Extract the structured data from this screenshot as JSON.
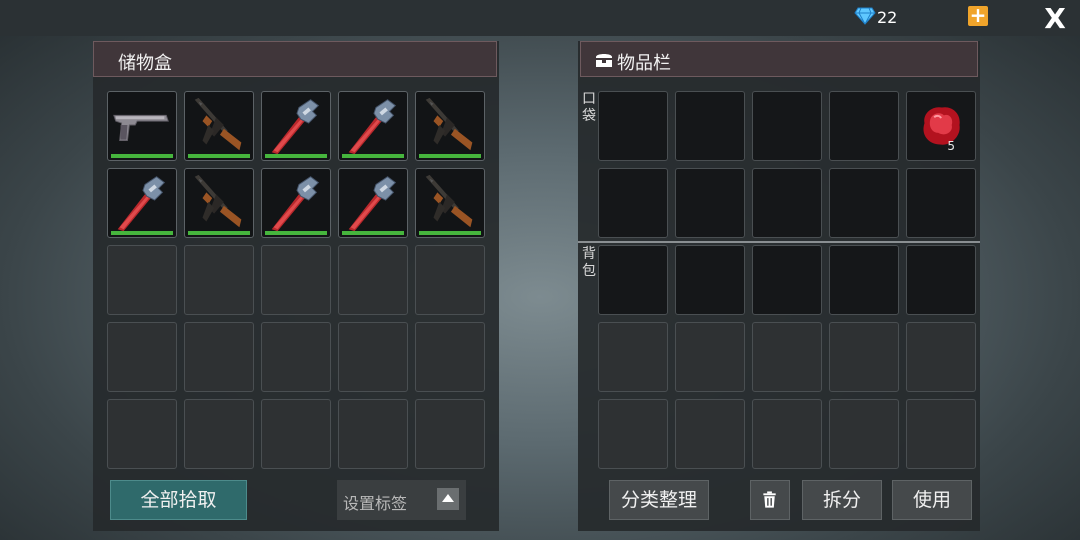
{
  "header": {
    "gem_icon": "diamond-icon",
    "gem_count": "22",
    "plus_symbol": "+",
    "close_symbol": "X"
  },
  "storage": {
    "title": "储物盒",
    "durability_color": "#46b53d",
    "slots": [
      {
        "item": "pistol"
      },
      {
        "item": "assault-rifle"
      },
      {
        "item": "pipe-wrench"
      },
      {
        "item": "pipe-wrench"
      },
      {
        "item": "assault-rifle"
      },
      {
        "item": "pipe-wrench"
      },
      {
        "item": "assault-rifle"
      },
      {
        "item": "pipe-wrench"
      },
      {
        "item": "pipe-wrench"
      },
      {
        "item": "assault-rifle"
      },
      {
        "item": ""
      },
      {
        "item": ""
      },
      {
        "item": ""
      },
      {
        "item": ""
      },
      {
        "item": ""
      },
      {
        "item": ""
      },
      {
        "item": ""
      },
      {
        "item": ""
      },
      {
        "item": ""
      },
      {
        "item": ""
      },
      {
        "item": ""
      },
      {
        "item": ""
      },
      {
        "item": ""
      },
      {
        "item": ""
      },
      {
        "item": ""
      }
    ],
    "pickup_all_label": "全部拾取",
    "tag_label": "设置标签"
  },
  "inventory": {
    "title": "物品栏",
    "title_icon": "chest-icon",
    "pocket_label": "口袋",
    "backpack_label": "背包",
    "pocket_slots": [
      {
        "item": ""
      },
      {
        "item": ""
      },
      {
        "item": ""
      },
      {
        "item": ""
      },
      {
        "item": "red-gem",
        "qty": "5"
      },
      {
        "item": ""
      },
      {
        "item": ""
      },
      {
        "item": ""
      },
      {
        "item": ""
      },
      {
        "item": ""
      }
    ],
    "backpack_slots": [
      {
        "item": ""
      },
      {
        "item": ""
      },
      {
        "item": ""
      },
      {
        "item": ""
      },
      {
        "item": ""
      },
      {
        "item": ""
      },
      {
        "item": ""
      },
      {
        "item": ""
      },
      {
        "item": ""
      },
      {
        "item": ""
      },
      {
        "item": ""
      },
      {
        "item": ""
      },
      {
        "item": ""
      },
      {
        "item": ""
      },
      {
        "item": ""
      }
    ],
    "sort_label": "分类整理",
    "trash_icon": "trash-icon",
    "split_label": "拆分",
    "use_label": "使用"
  }
}
